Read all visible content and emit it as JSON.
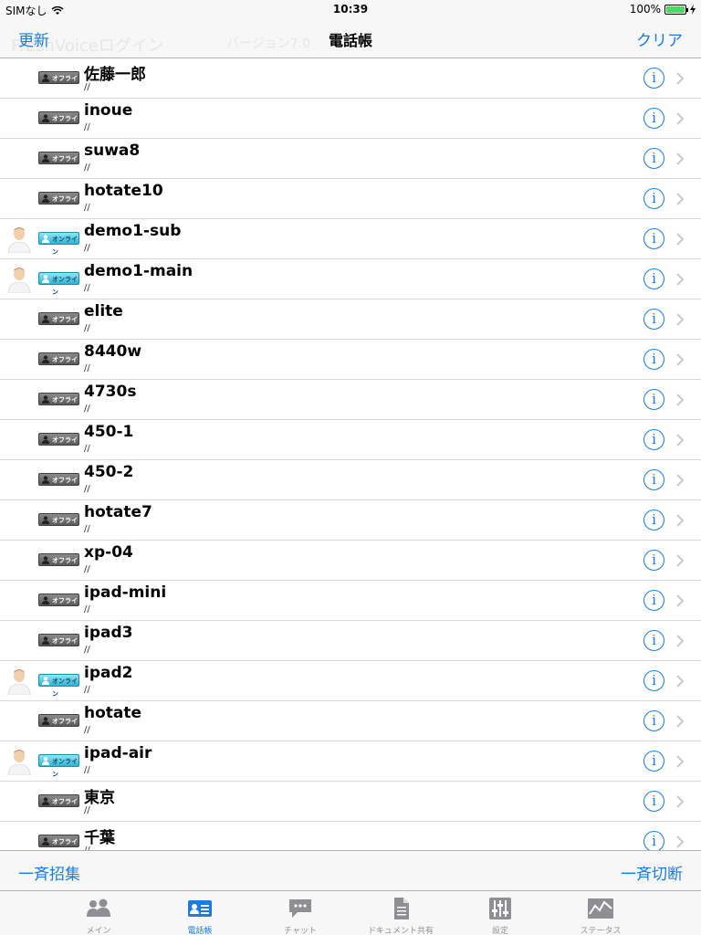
{
  "status_bar": {
    "carrier": "SIMなし",
    "time": "10:39",
    "battery": "100%",
    "battery_level": 1.0
  },
  "nav": {
    "left_button": "更新",
    "title": "電話帳",
    "right_button": "クリア",
    "ghost_left": "FreshVoiceログイン",
    "ghost_right": "バージョン7.0　　ド:2"
  },
  "contacts": [
    {
      "name": "佐藤一郎",
      "sub": "//",
      "online": false,
      "status": "オフライン"
    },
    {
      "name": "inoue",
      "sub": "//",
      "online": false,
      "status": "オフライン"
    },
    {
      "name": "suwa8",
      "sub": "//",
      "online": false,
      "status": "オフライン"
    },
    {
      "name": "hotate10",
      "sub": "//",
      "online": false,
      "status": "オフライン"
    },
    {
      "name": "demo1-sub",
      "sub": "//",
      "online": true,
      "status": "オンライン"
    },
    {
      "name": "demo1-main",
      "sub": "//",
      "online": true,
      "status": "オンライン"
    },
    {
      "name": "elite",
      "sub": "//",
      "online": false,
      "status": "オフライン"
    },
    {
      "name": "8440w",
      "sub": "//",
      "online": false,
      "status": "オフライン"
    },
    {
      "name": "4730s",
      "sub": "//",
      "online": false,
      "status": "オフライン"
    },
    {
      "name": "450-1",
      "sub": "//",
      "online": false,
      "status": "オフライン"
    },
    {
      "name": "450-2",
      "sub": "//",
      "online": false,
      "status": "オフライン"
    },
    {
      "name": "hotate7",
      "sub": "//",
      "online": false,
      "status": "オフライン"
    },
    {
      "name": "xp-04",
      "sub": "//",
      "online": false,
      "status": "オフライン"
    },
    {
      "name": "ipad-mini",
      "sub": "//",
      "online": false,
      "status": "オフライン"
    },
    {
      "name": "ipad3",
      "sub": "//",
      "online": false,
      "status": "オフライン"
    },
    {
      "name": "ipad2",
      "sub": "//",
      "online": true,
      "status": "オンライン"
    },
    {
      "name": "hotate",
      "sub": "//",
      "online": false,
      "status": "オフライン"
    },
    {
      "name": "ipad-air",
      "sub": "//",
      "online": true,
      "status": "オンライン"
    },
    {
      "name": "東京",
      "sub": "//",
      "online": false,
      "status": "オフライン"
    },
    {
      "name": "千葉",
      "sub": "//",
      "online": false,
      "status": "オフライン"
    }
  ],
  "toolbar": {
    "left_button": "一斉招集",
    "right_button": "一斉切断"
  },
  "tabs": [
    {
      "label": "メイン",
      "icon": "people-icon",
      "active": false
    },
    {
      "label": "電話帳",
      "icon": "contact-card-icon",
      "active": true
    },
    {
      "label": "チャット",
      "icon": "chat-bubble-icon",
      "active": false
    },
    {
      "label": "ドキュメント共有",
      "icon": "document-icon",
      "active": false
    },
    {
      "label": "設定",
      "icon": "sliders-icon",
      "active": false
    },
    {
      "label": "ステータス",
      "icon": "status-graph-icon",
      "active": false
    }
  ],
  "colors": {
    "accent": "#1a7ce0",
    "inactive_tab": "#929292",
    "online_badge": "#2fb2d6",
    "offline_badge": "#5a5a5a"
  }
}
